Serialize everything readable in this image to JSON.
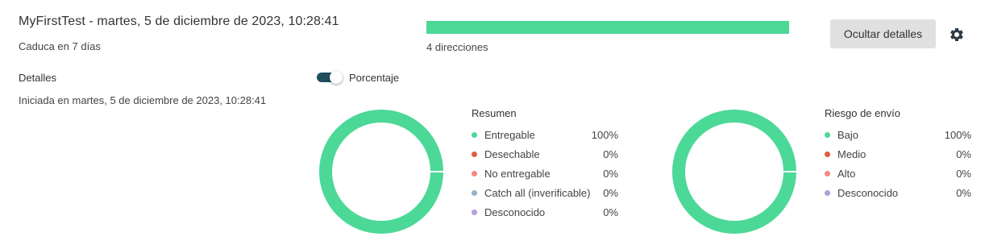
{
  "header": {
    "title": "MyFirstTest - martes, 5 de diciembre de 2023, 10:28:41",
    "expires": "Caduca en 7 días"
  },
  "progress": {
    "fraction": 1.0,
    "color": "#4cd897",
    "label": "4 direcciones"
  },
  "actions": {
    "hide_details_label": "Ocultar detalles",
    "settings_icon": "gear-icon"
  },
  "details": {
    "title": "Detalles",
    "started": "Iniciada en martes, 5 de diciembre de 2023, 10:28:41"
  },
  "toggle": {
    "label": "Porcentaje",
    "on": true
  },
  "summary": {
    "title": "Resumen",
    "items": [
      {
        "label": "Entregable",
        "value": "100%",
        "color": "#4cd897"
      },
      {
        "label": "Desechable",
        "value": "0%",
        "color": "#e05d44"
      },
      {
        "label": "No entregable",
        "value": "0%",
        "color": "#f28b82"
      },
      {
        "label": "Catch all (inverificable)",
        "value": "0%",
        "color": "#93b4c6"
      },
      {
        "label": "Desconocido",
        "value": "0%",
        "color": "#b39ddb"
      }
    ]
  },
  "risk": {
    "title": "Riesgo de envío",
    "items": [
      {
        "label": "Bajo",
        "value": "100%",
        "color": "#4cd897"
      },
      {
        "label": "Medio",
        "value": "0%",
        "color": "#e05d44"
      },
      {
        "label": "Alto",
        "value": "0%",
        "color": "#f28b82"
      },
      {
        "label": "Desconocido",
        "value": "0%",
        "color": "#b39ddb"
      }
    ]
  },
  "chart_data": [
    {
      "type": "pie",
      "categories": [
        "Entregable",
        "Desechable",
        "No entregable",
        "Catch all (inverificable)",
        "Desconocido"
      ],
      "values": [
        100,
        0,
        0,
        0,
        0
      ],
      "title": "Resumen"
    },
    {
      "type": "pie",
      "categories": [
        "Bajo",
        "Medio",
        "Alto",
        "Desconocido"
      ],
      "values": [
        100,
        0,
        0,
        0
      ],
      "title": "Riesgo de envío"
    }
  ]
}
